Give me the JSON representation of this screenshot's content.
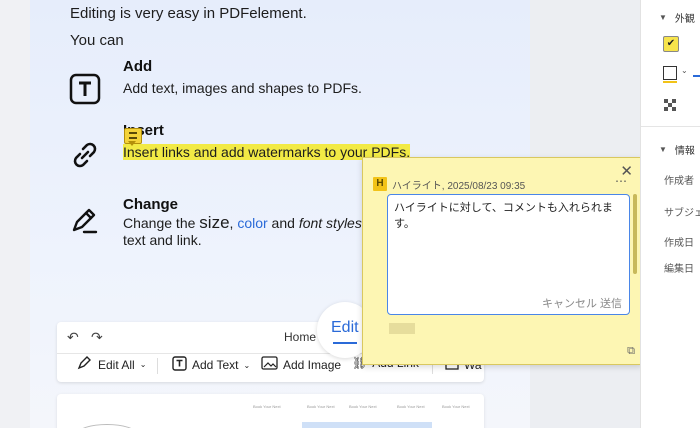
{
  "document": {
    "intro_line1": "Editing is very easy in PDFelement.",
    "intro_line2": "You can",
    "features": [
      {
        "title": "Add",
        "desc": "Add text, images and shapes to PDFs."
      },
      {
        "title": "Insert",
        "desc": "Insert links and add watermarks to your PDFs."
      },
      {
        "title": "Change",
        "desc_part1": "Change the ",
        "desc_size": "size",
        "desc_sep1": ", ",
        "desc_color": "color",
        "desc_and": " and ",
        "desc_font": "font styles",
        "desc_line2": "text and link."
      }
    ]
  },
  "toolbar_preview": {
    "undo": "↶",
    "redo": "↷",
    "home": "Home",
    "edit_tab": "Edit",
    "edit_all": "Edit All",
    "add_text": "Add Text",
    "add_image": "Add Image",
    "add_link": "Add Link",
    "wa": "Wa"
  },
  "thumbnail": {
    "small_labels": [
      "Book Your Next",
      "Book Your Next",
      "Book Your Next",
      "Book Your Next",
      "Book Your Next"
    ]
  },
  "comment_popup": {
    "badge": "H",
    "meta": "ハイライト, 2025/08/23 09:35",
    "more": "⋯",
    "close": "✕",
    "text": "ハイライトに対して、コメントも入れられます。",
    "cancel": "キャンセル",
    "send": "送信"
  },
  "right_panel": {
    "section_appearance": "外観",
    "section_info": "情報",
    "info_labels": [
      "作成者",
      "サブジェ",
      "作成日",
      "編集日"
    ],
    "checkbox_mark": "✔",
    "colors": {
      "highlight": "#f7e44c",
      "accent": "#2a6ad8"
    }
  }
}
